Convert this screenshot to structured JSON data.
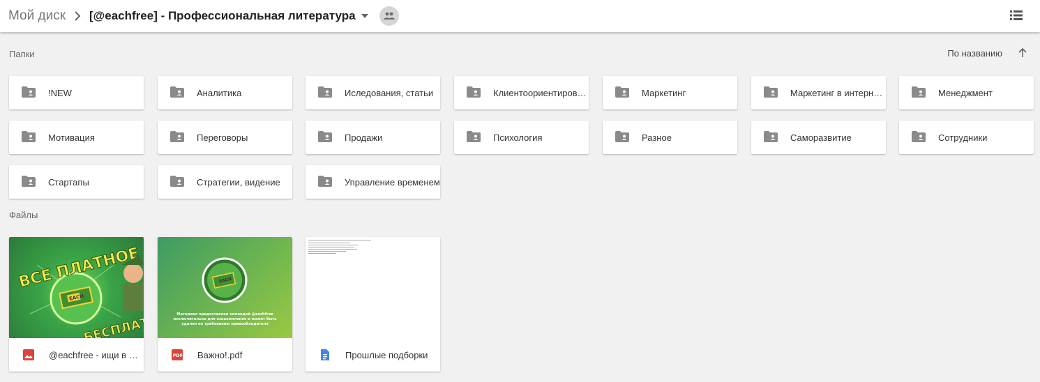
{
  "breadcrumb": {
    "root": "Мой диск",
    "current": "[@eachfree] - Профессиональная литература"
  },
  "icons": {
    "separator": "chevron-right-icon",
    "dropdown": "caret-down-icon",
    "shared": "people-icon",
    "view": "list-view-icon",
    "sort": "arrow-up-icon",
    "folder": "shared-folder-icon",
    "image_file": "image-file-icon",
    "pdf_file": "pdf-file-icon",
    "doc_file": "doc-file-icon"
  },
  "sections": {
    "folders_label": "Папки",
    "files_label": "Файлы"
  },
  "sort": {
    "label": "По названию"
  },
  "folders": [
    "!NEW",
    "Аналитика",
    "Иследования, статьи",
    "Клиентоориентированность",
    "Маркетинг",
    "Маркетинг в интернете",
    "Менеджмент",
    "Мотивация",
    "Переговоры",
    "Продажи",
    "Психология",
    "Разное",
    "Саморазвитие",
    "Сотрудники",
    "Стартапы",
    "Стратегии, видение",
    "Управление временем"
  ],
  "files": [
    {
      "name": "@eachfree - ищи в поиске",
      "type": "image"
    },
    {
      "name": "Важно!.pdf",
      "type": "pdf"
    },
    {
      "name": "Прошлые подборки",
      "type": "doc"
    }
  ],
  "thumbnails": {
    "banner_top": "ВСЕ ПЛАТНОЕ",
    "banner_bottom": "БЕСПЛАТНО",
    "coin_label": "EACH",
    "pdf_caption": "Материал предоставлен командой @eachfree исключительно для ознакомления и может быть удален по требованию правообладателя"
  },
  "colors": {
    "header_bg": "#ffffff",
    "page_bg": "#f1f1f1",
    "icon_gray": "#8a8a8a",
    "image_icon_red": "#db4437",
    "pdf_icon_red": "#db4437",
    "doc_icon_blue": "#4285f4"
  }
}
